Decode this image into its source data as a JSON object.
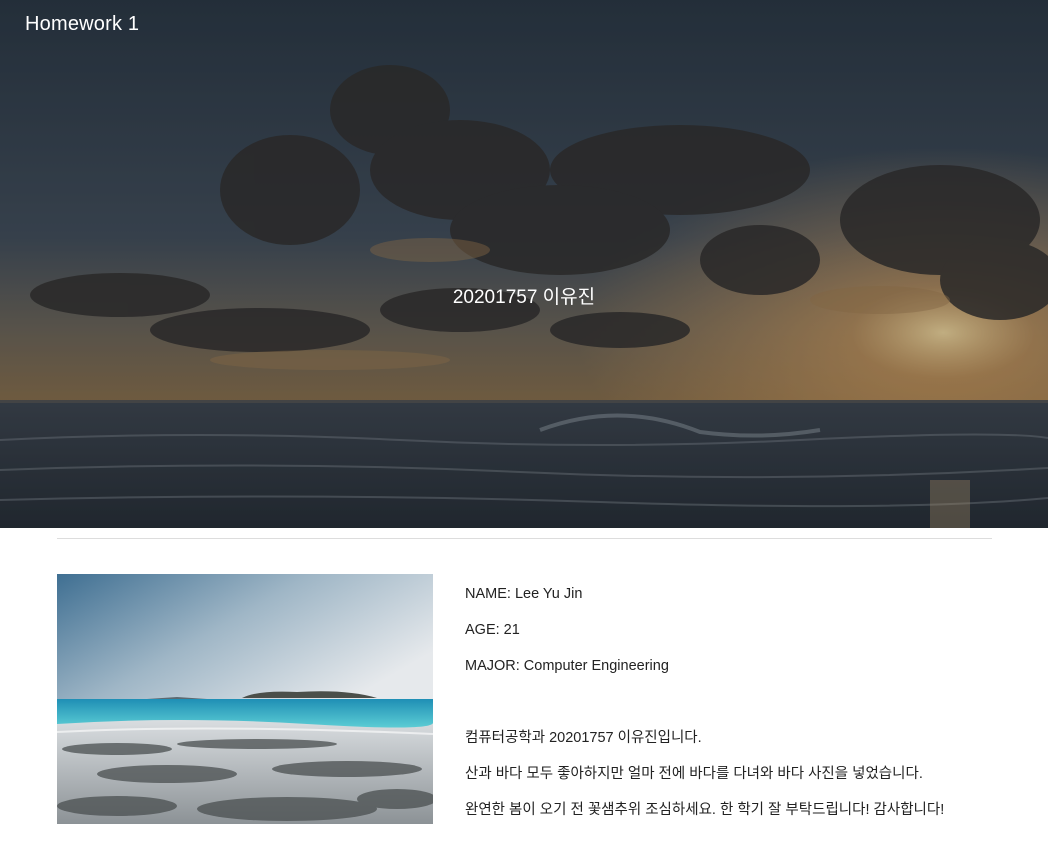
{
  "header": {
    "brand": "Homework 1",
    "hero_title": "20201757 이유진"
  },
  "profile": {
    "name_line": "NAME: Lee Yu Jin",
    "age_line": "AGE: 21",
    "major_line": "MAJOR: Computer Engineering",
    "intro_lines": [
      "컴퓨터공학과 20201757 이유진입니다.",
      "산과 바다 모두 좋아하지만 얼마 전에 바다를 다녀와 바다 사진을 넣었습니다.",
      "완연한 봄이 오기 전 꽃샘추위 조심하세요. 한 학기 잘 부탁드립니다! 감사합니다!"
    ]
  },
  "colors": {
    "hero_overlay": "#1b2530",
    "sunset": "#f2b45a",
    "sea_turquoise": "#33b8c6",
    "text": "#222222"
  }
}
